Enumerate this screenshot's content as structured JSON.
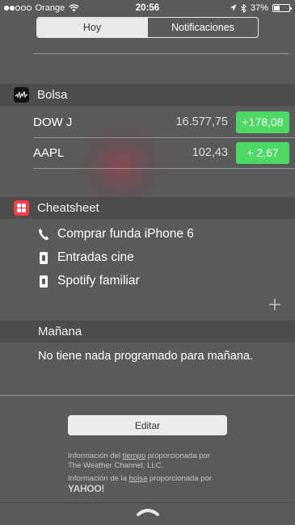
{
  "status_bar": {
    "carrier": "Orange",
    "time": "20:56",
    "battery": "37%",
    "battery_level": 0.37
  },
  "segmented": {
    "today_label": "Hoy",
    "notifications_label": "Notificaciones"
  },
  "stocks": {
    "title": "Bolsa",
    "rows": [
      {
        "symbol": "DOW J",
        "value": "16.577,75",
        "change": "+178,08"
      },
      {
        "symbol": "AAPL",
        "value": "102,43",
        "change": "+  2,67"
      }
    ],
    "change_color": "#4cd964"
  },
  "cheatsheet": {
    "title": "Cheatsheet",
    "accent": "#ff3b4a",
    "items": [
      {
        "label": "Comprar funda iPhone 6",
        "icon": "phone-icon"
      },
      {
        "label": "Entradas cine",
        "icon": "ticket-icon"
      },
      {
        "label": "Spotify familiar",
        "icon": "ticket-icon"
      }
    ]
  },
  "tomorrow": {
    "title": "Mañana",
    "empty_text": "No tiene nada programado para mañana."
  },
  "edit_label": "Editar",
  "credits": {
    "weather_prefix": "Información del ",
    "weather_link": "tiempo",
    "weather_suffix": " proporcionada por",
    "weather_provider": "The Weather Channel, LLC.",
    "stocks_prefix": "Información de la ",
    "stocks_link": "bolsa",
    "stocks_suffix": " proporcionada por",
    "stocks_provider": "YAHOO!"
  }
}
